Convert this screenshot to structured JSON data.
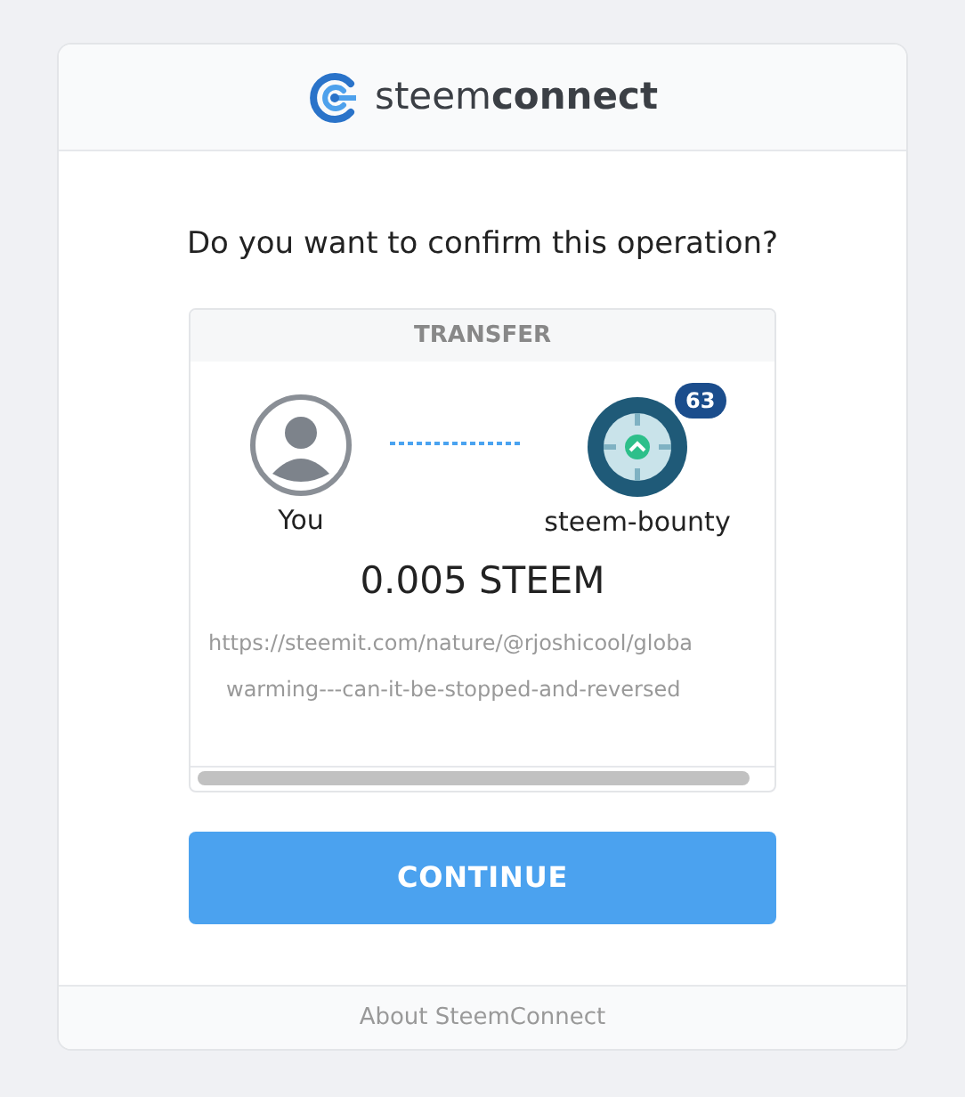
{
  "header": {
    "brand": "steem**connect**"
  },
  "question": "Do you want to confirm this operation?",
  "operation": {
    "type": "TRANSFER",
    "from": {
      "name": "You"
    },
    "to": {
      "name": "steem-bounty",
      "reputation": "63"
    },
    "amount": "0.005 STEEM",
    "memo_lines": [
      "https://steemit.com/nature/@rjoshicool/globa",
      "warming---can-it-be-stopped-and-reversed"
    ]
  },
  "continue_button": "CONTINUE",
  "footer_link": "About SteemConnect"
}
